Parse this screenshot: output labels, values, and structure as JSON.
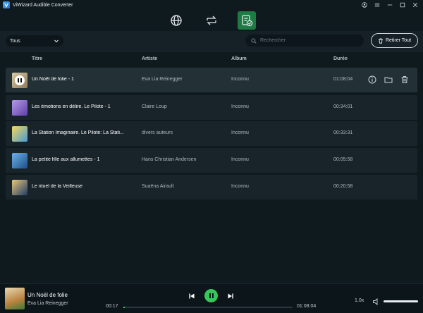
{
  "window": {
    "title": "ViWizard Audible Converter"
  },
  "tabs": [
    {
      "icon": "globe-icon",
      "active": false
    },
    {
      "icon": "convert-icon",
      "active": false
    },
    {
      "icon": "converted-list-icon",
      "active": true
    }
  ],
  "filter": {
    "selected": "Tous"
  },
  "search": {
    "placeholder": "Rechercher"
  },
  "remove_all": {
    "label": "Retirer Tout"
  },
  "columns": {
    "title": "Titre",
    "artist": "Artiste",
    "album": "Album",
    "duration": "Durée"
  },
  "rows": [
    {
      "title": "Un Noël de folie - 1",
      "artist": "Eva Lia Reinegger",
      "album": "Inconnu",
      "duration": "01:08:04",
      "cover_color": "#c8b99a",
      "playing": true
    },
    {
      "title": "Les émotions en délire. Le Pilote - 1",
      "artist": "Claire Loup",
      "album": "Inconnu",
      "duration": "00:34:01",
      "cover_color": "#9b7bd4",
      "playing": false
    },
    {
      "title": "La Station Imaginaire. Le Pilote: La Stati...",
      "artist": "divers auteurs",
      "album": "Inconnu",
      "duration": "00:33:31",
      "cover_color": "#e8c440",
      "playing": false
    },
    {
      "title": "La petite fille aux allumettes - 1",
      "artist": "Hans Christian Andersen",
      "album": "Inconnu",
      "duration": "00:05:58",
      "cover_color": "#3d7fc4",
      "playing": false
    },
    {
      "title": "Le rituel de la Veilleuse",
      "artist": "Suaëna Airault",
      "album": "Inconnu",
      "duration": "00:20:58",
      "cover_color": "#2f5a8a",
      "playing": false
    }
  ],
  "player": {
    "title": "Un Noël de folie",
    "artist": "Eva Lia Reinegger",
    "elapsed": "00:17",
    "total": "01:08:04",
    "progress": 0.004,
    "speed": "1.0x",
    "volume": 1.0,
    "accent": "#35c759"
  }
}
